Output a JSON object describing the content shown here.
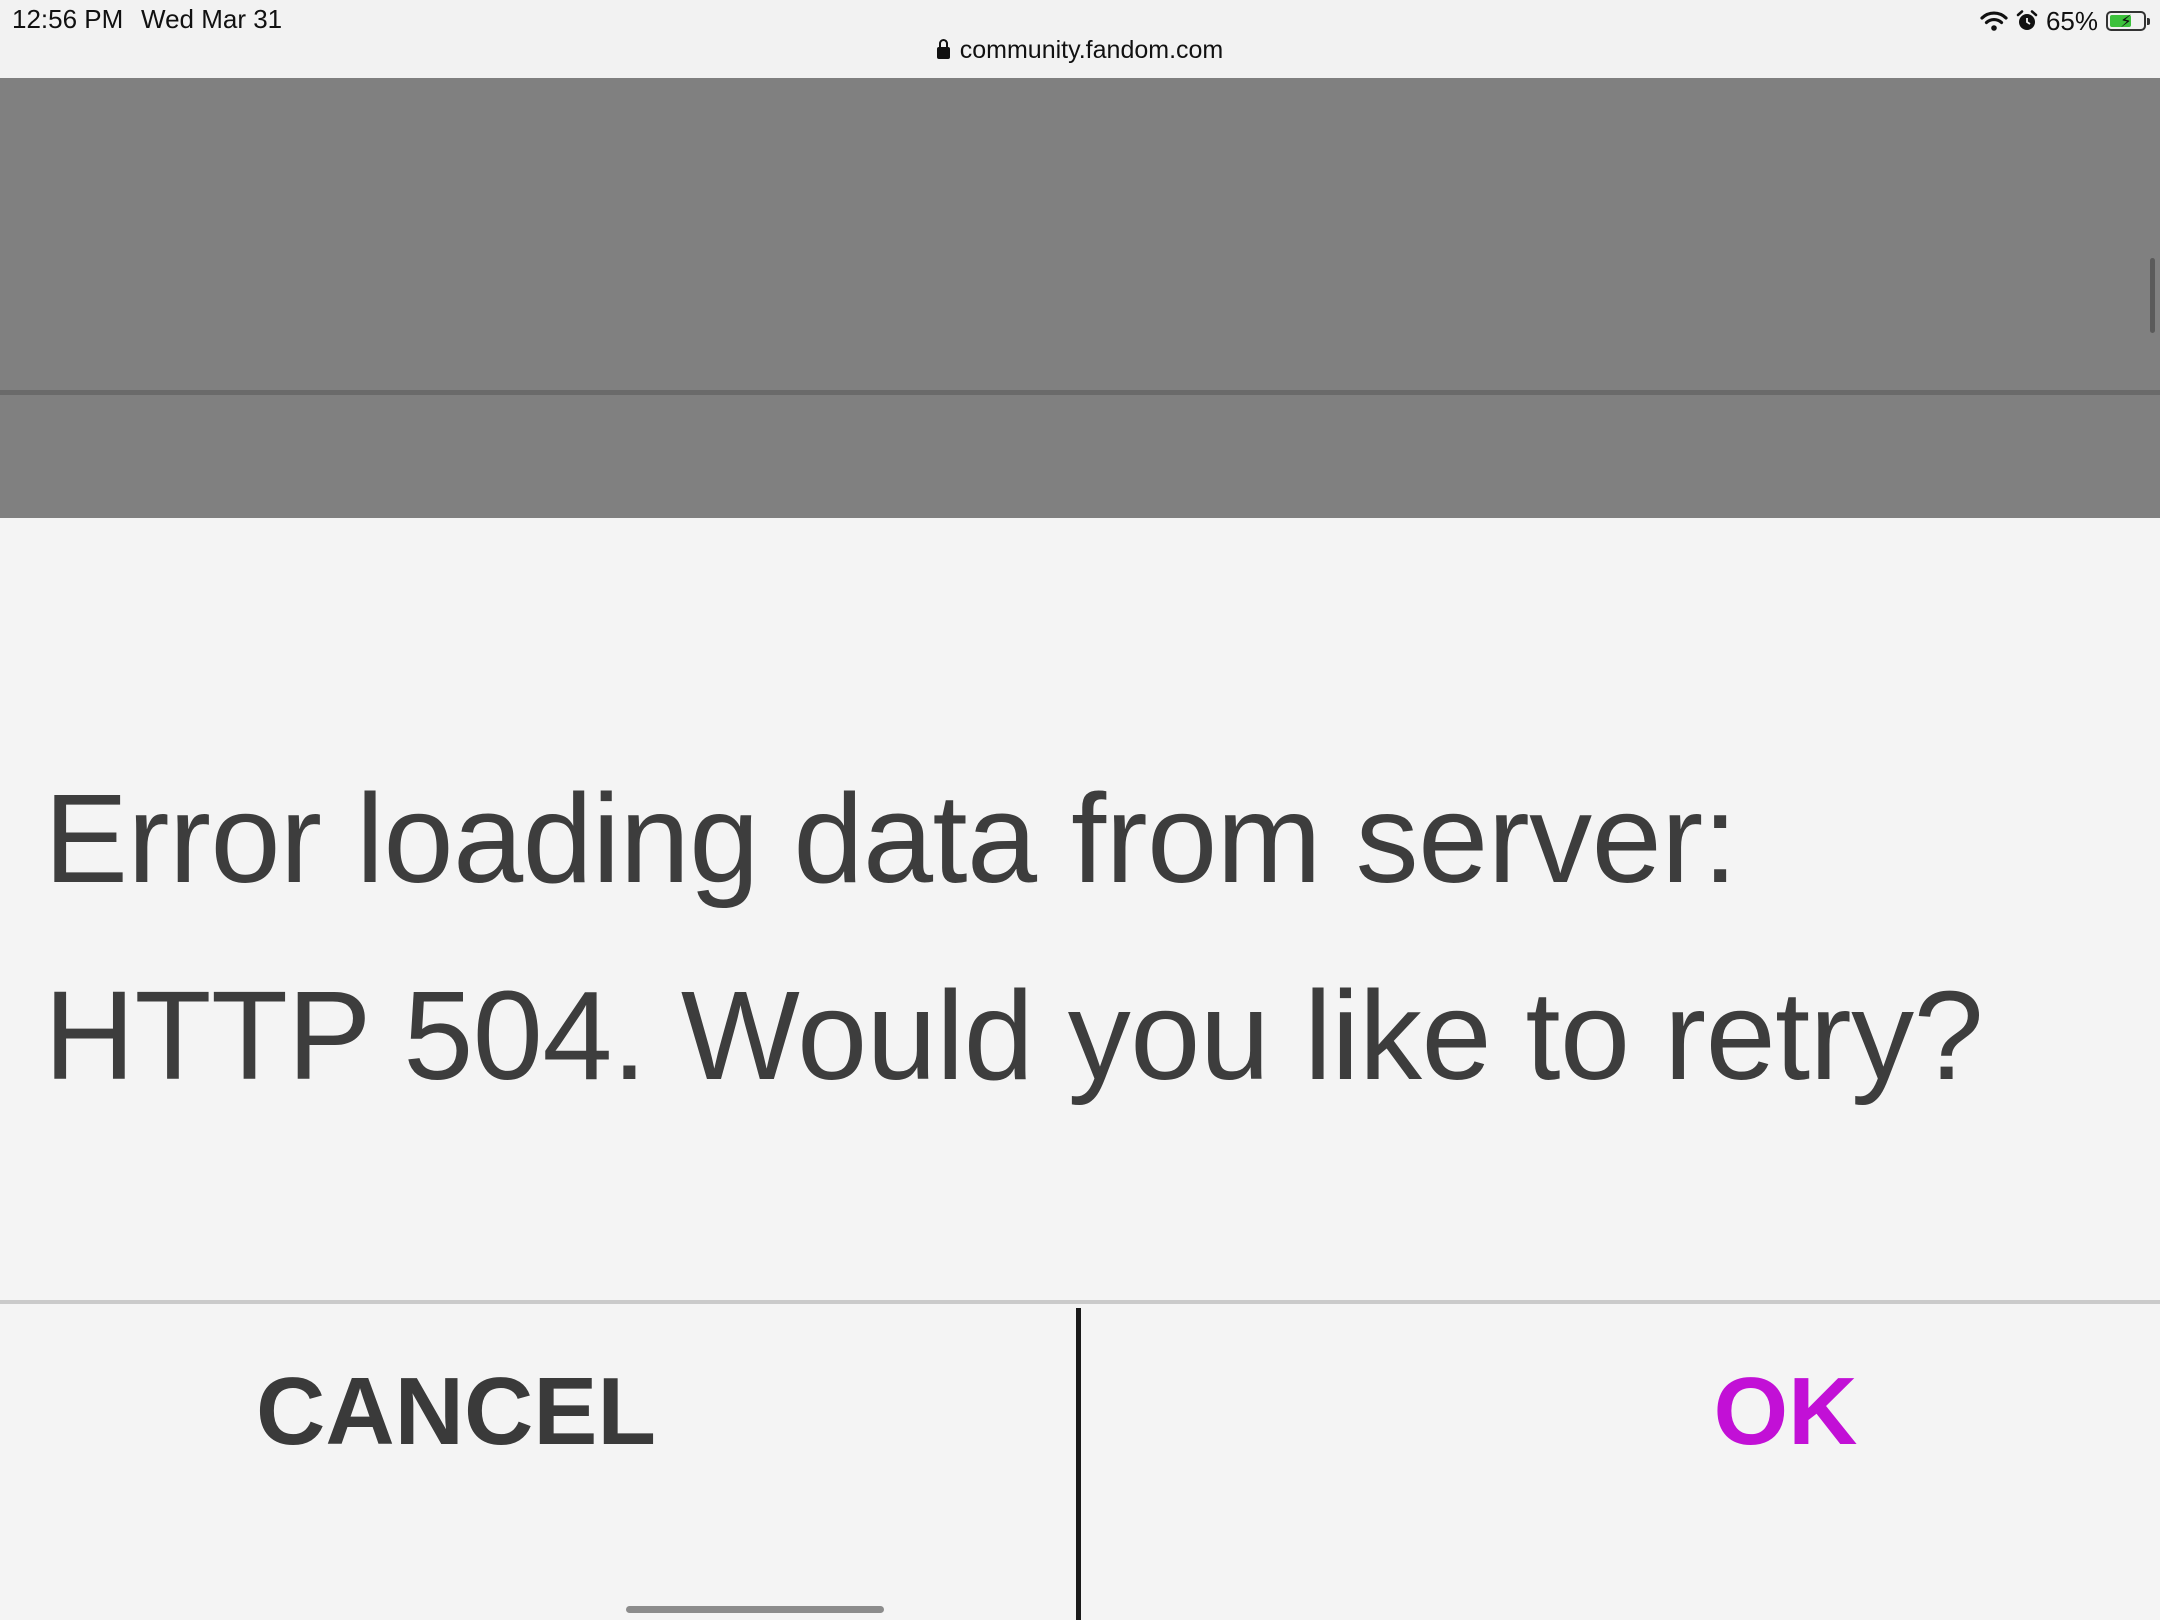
{
  "status_bar": {
    "time": "12:56 PM",
    "date": "Wed Mar 31",
    "battery_percent": "65%",
    "battery_level": 0.65,
    "icons": [
      "wifi-icon",
      "alarm-icon",
      "battery-charging-icon"
    ]
  },
  "browser": {
    "url": "community.fandom.com"
  },
  "dialog": {
    "message_line1": "Error loading data from server:",
    "message_line2": "HTTP 504. Would you like to retry?",
    "cancel_label": "CANCEL",
    "ok_label": "OK"
  },
  "colors": {
    "accent": "#c210d6",
    "overlay": "#808080",
    "dialog_bg": "#f4f4f4",
    "text": "#3d3d3d"
  }
}
